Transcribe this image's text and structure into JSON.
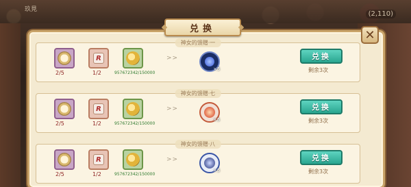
{
  "header": {
    "title": "兑换",
    "close_symbol": "✕"
  },
  "background": {
    "player_name": "玖見",
    "counter": "(2,110)"
  },
  "rows": [
    {
      "label": "神女的馈赠·一",
      "costs": [
        {
          "icon": "flower-icon",
          "count": "2/5"
        },
        {
          "icon": "dice-icon",
          "count": "1/2"
        },
        {
          "icon": "coin-icon",
          "count": "957672342/150000"
        }
      ],
      "arrow": ">>",
      "reward": {
        "icon": "blue-orb-icon",
        "qty": "×5"
      },
      "button": "兑换",
      "remaining": "剩余3次"
    },
    {
      "label": "神女的馈赠·七",
      "costs": [
        {
          "icon": "flower-icon",
          "count": "2/5"
        },
        {
          "icon": "dice-icon",
          "count": "1/2"
        },
        {
          "icon": "coin-icon",
          "count": "957672342/150000"
        }
      ],
      "arrow": ">>",
      "reward": {
        "icon": "red-orb-icon",
        "qty": "×5"
      },
      "button": "兑换",
      "remaining": "剩余3次"
    },
    {
      "label": "神女的馈赠·八",
      "costs": [
        {
          "icon": "flower-icon",
          "count": "2/5"
        },
        {
          "icon": "dice-icon",
          "count": "1/2"
        },
        {
          "icon": "coin-icon",
          "count": "957672342/150000"
        }
      ],
      "arrow": ">>",
      "reward": {
        "icon": "navy-orb-icon",
        "qty": "×5"
      },
      "button": "兑换",
      "remaining": "剩余3次"
    }
  ],
  "colors": {
    "button": "#2aa690",
    "panel": "#f4ead1",
    "cost_red": "#8b1e1e",
    "coin_green": "#2e7a2e"
  }
}
